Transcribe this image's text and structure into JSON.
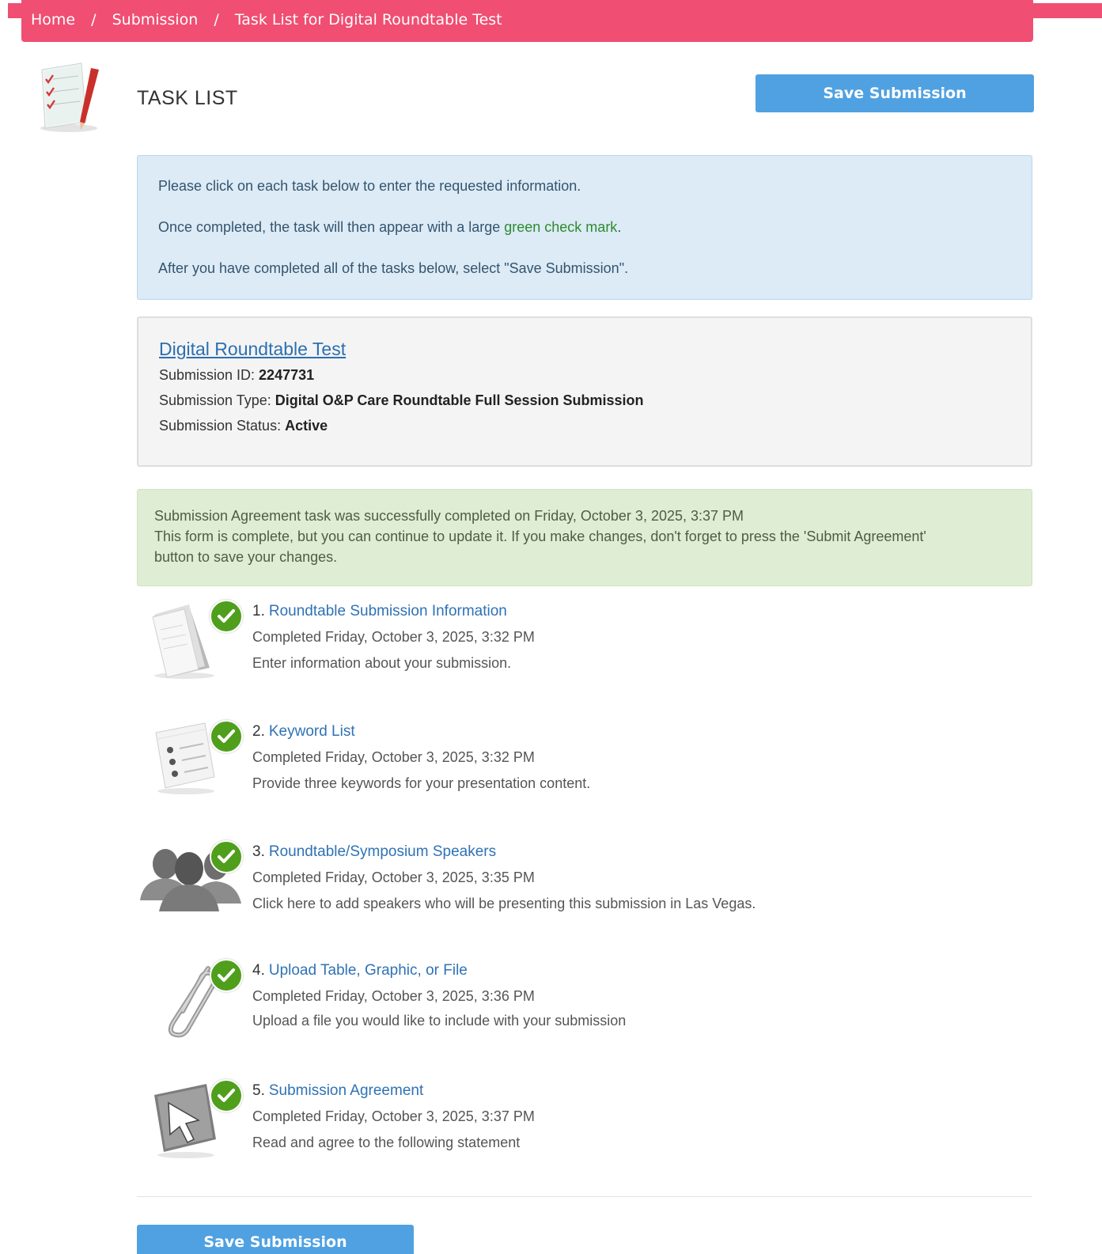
{
  "breadcrumb": {
    "home": "Home",
    "submission": "Submission",
    "current": "Task List for Digital Roundtable Test",
    "separator": "/"
  },
  "header": {
    "title": "TASK LIST",
    "save_label": "Save Submission"
  },
  "info": {
    "line1": "Please click on each task below to enter the requested information.",
    "line2_before": "Once completed, the task will then appear with a large ",
    "line2_green": "green check mark",
    "line2_after": ".",
    "line3": "After you have completed all of the tasks below, select \"Save Submission\"."
  },
  "submission": {
    "title": "Digital Roundtable Test",
    "id_label": "Submission ID: ",
    "id_value": "2247731",
    "type_label": "Submission Type: ",
    "type_value": "Digital O&P Care Roundtable Full Session Submission",
    "status_label": "Submission Status: ",
    "status_value": "Active"
  },
  "success": {
    "line1": "Submission Agreement task was successfully completed on Friday, October 3, 2025, 3:37 PM",
    "line2": "This form is complete, but you can continue to update it. If you make changes, don't forget to press the 'Submit Agreement'",
    "line3": "button to save your changes."
  },
  "tasks": [
    {
      "number": "1.",
      "title": "Roundtable Submission Information",
      "completed": "Completed Friday, October 3, 2025, 3:32 PM",
      "description": "Enter information about your submission.",
      "icon": "documents-icon"
    },
    {
      "number": "2.",
      "title": "Keyword List",
      "completed": "Completed Friday, October 3, 2025, 3:32 PM",
      "description": "Provide three keywords for your presentation content.",
      "icon": "list-icon"
    },
    {
      "number": "3.",
      "title": "Roundtable/Symposium Speakers",
      "completed": "Completed Friday, October 3, 2025, 3:35 PM",
      "description": "Click here to add speakers who will be presenting this submission in Las Vegas.",
      "icon": "people-icon"
    },
    {
      "number": "4.",
      "title": "Upload Table, Graphic, or File",
      "completed": "Completed Friday, October 3, 2025, 3:36 PM",
      "description": "Upload a file you would like to include with your submission",
      "icon": "paperclip-icon"
    },
    {
      "number": "5.",
      "title": "Submission Agreement",
      "completed": "Completed Friday, October 3, 2025, 3:37 PM",
      "description": "Read and agree to the following statement",
      "icon": "cursor-icon"
    }
  ],
  "footer": {
    "save_label": "Save Submission"
  },
  "colors": {
    "brand_pink": "#f04e72",
    "button_blue": "#4fa1e2",
    "check_green": "#4f9f1c",
    "link_blue": "#2f72b5"
  }
}
